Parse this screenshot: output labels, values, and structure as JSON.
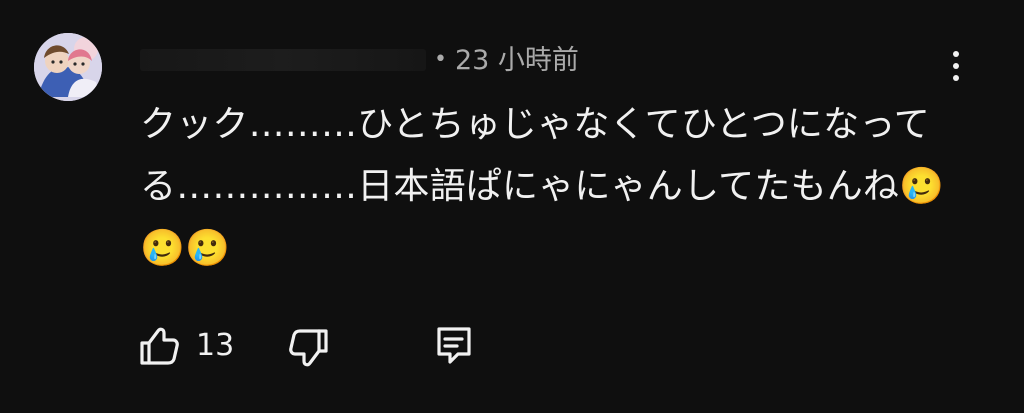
{
  "comment": {
    "author": "",
    "separator": "•",
    "timestamp": "23 小時前",
    "lines": [
      "クック………ひとちゅじゃなくてひとつになって",
      "る……………日本語ぱにゃにゃんしてたもんね🥲",
      "🥲🥲"
    ]
  },
  "actions": {
    "like_count": "13"
  },
  "icons": {
    "more": "more-vertical-icon",
    "like": "thumbs-up-icon",
    "dislike": "thumbs-down-icon",
    "reply": "reply-comment-icon"
  },
  "colors": {
    "background": "#0f0f0f",
    "text": "#f1f1f1",
    "secondary_text": "#aaaaaa"
  }
}
